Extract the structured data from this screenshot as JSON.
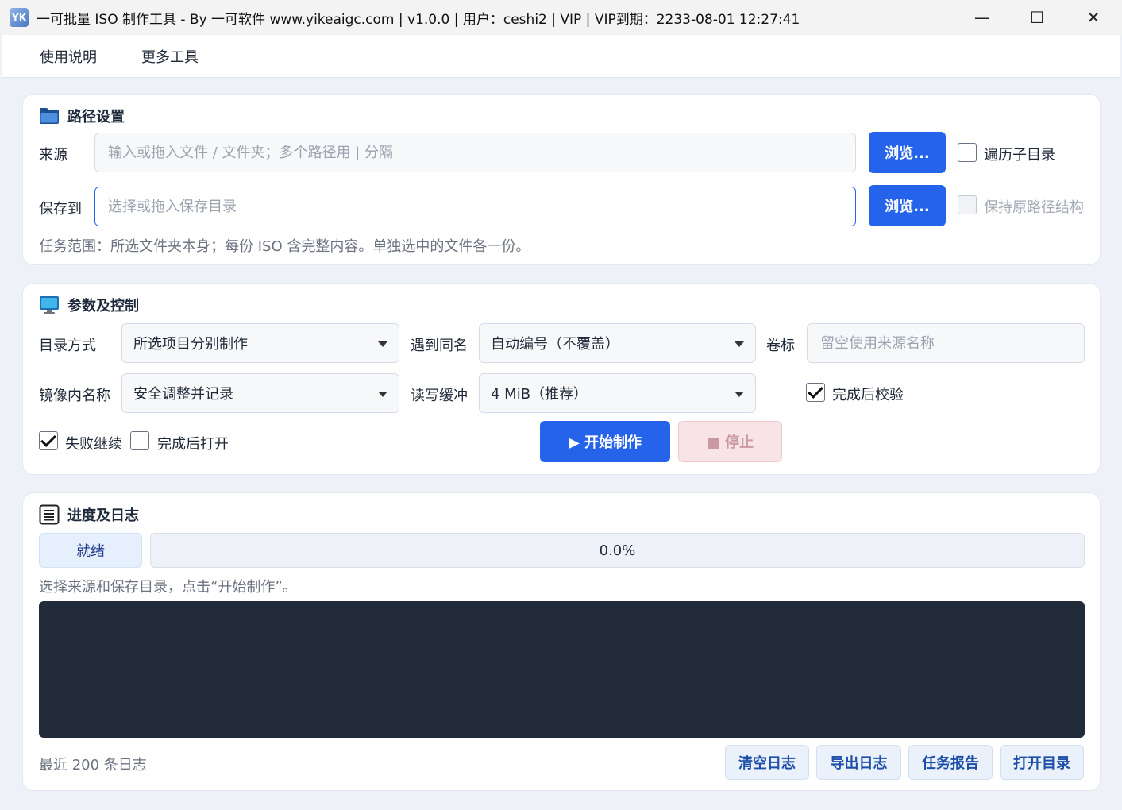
{
  "window": {
    "title": "一可批量 ISO 制作工具 - By 一可软件 www.yikeaigc.com | v1.0.0 | 用户：ceshi2 | VIP | VIP到期：2233-08-01 12:27:41",
    "icon_text": "YK",
    "minimize_glyph": "—",
    "maximize_glyph": "☐",
    "close_glyph": "✕"
  },
  "menu": {
    "items": [
      "使用说明",
      "更多工具"
    ]
  },
  "path_panel": {
    "title": "路径设置",
    "source_label": "来源",
    "source_placeholder": "输入或拖入文件 / 文件夹；多个路径用 | 分隔",
    "source_value": "",
    "browse_label": "浏览...",
    "recursive_label": "遍历子目录",
    "recursive_checked": false,
    "save_label": "保存到",
    "save_placeholder": "选择或拖入保存目录",
    "save_value": "",
    "browse2_label": "浏览...",
    "keep_path_label": "保持原路径结构",
    "keep_path_checked": false,
    "keep_path_disabled": true,
    "scope_note": "任务范围：所选文件夹本身；每份 ISO 含完整内容。单独选中的文件各一份。"
  },
  "params_panel": {
    "title": "参数及控制",
    "dir_mode_label": "目录方式",
    "dir_mode_value": "所选项目分别制作",
    "same_name_label": "遇到同名",
    "same_name_value": "自动编号（不覆盖）",
    "volume_label": "卷标",
    "volume_placeholder": "留空使用来源名称",
    "volume_value": "",
    "inner_name_label": "镜像内名称",
    "inner_name_value": "安全调整并记录",
    "buffer_label": "读写缓冲",
    "buffer_value": "4 MiB（推荐）",
    "verify_label": "完成后校验",
    "verify_checked": true,
    "continue_label": "失败继续",
    "continue_checked": true,
    "open_after_label": "完成后打开",
    "open_after_checked": false,
    "start_label": "▶ 开始制作",
    "stop_label": "■ 停止"
  },
  "log_panel": {
    "title": "进度及日志",
    "status": "就绪",
    "progress_percent": 0.0,
    "progress_text": "0.0%",
    "hint": "选择来源和保存目录，点击“开始制作”。",
    "log_lines": [],
    "footer_note": "最近 200 条日志",
    "buttons": [
      "清空日志",
      "导出日志",
      "任务报告",
      "打开目录"
    ]
  },
  "colors": {
    "accent": "#2563eb",
    "log_bg": "#222b3a",
    "stop_bg": "#f8e4e6"
  }
}
